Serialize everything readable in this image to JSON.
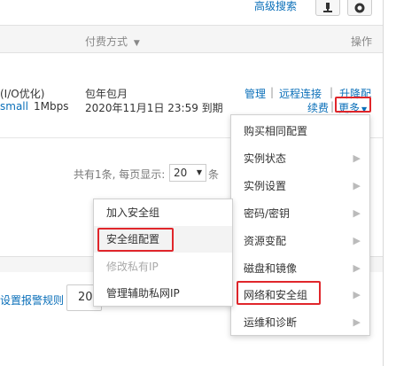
{
  "toolbar": {
    "advanced_search": "高级搜索",
    "icons": [
      "microscope-icon",
      "gear-icon"
    ]
  },
  "table": {
    "col_payment": "付费方式",
    "col_ops": "操作",
    "row": {
      "spec_line1": "(I/O优化)",
      "spec_line2_a": "small",
      "spec_line2_b": "1Mbps",
      "billing_line1": "包年包月",
      "billing_line2": "2020年11月1日 23:59 到期",
      "op_manage": "管理",
      "op_remote": "远程连接",
      "op_upgrade": "升降配",
      "op_renew": "续费",
      "op_more": "更多"
    }
  },
  "pager": {
    "summary": "共有1条, 每页显示:",
    "page_size": "20",
    "unit": "条"
  },
  "lower": {
    "alarm_link": "设置报警规则",
    "input_value": "20"
  },
  "more_menu": {
    "items": [
      {
        "label": "购买相同配置",
        "submenu": false
      },
      {
        "label": "实例状态",
        "submenu": true
      },
      {
        "label": "实例设置",
        "submenu": true
      },
      {
        "label": "密码/密钥",
        "submenu": true
      },
      {
        "label": "资源变配",
        "submenu": true
      },
      {
        "label": "磁盘和镜像",
        "submenu": true
      },
      {
        "label": "网络和安全组",
        "submenu": true
      },
      {
        "label": "运维和诊断",
        "submenu": true
      }
    ]
  },
  "sub_menu": {
    "items": [
      {
        "label": "加入安全组",
        "disabled": false
      },
      {
        "label": "安全组配置",
        "disabled": false
      },
      {
        "label": "修改私有IP",
        "disabled": true
      },
      {
        "label": "管理辅助私网IP",
        "disabled": false
      }
    ]
  },
  "colors": {
    "link": "#0a6fb9",
    "highlight_box": "#e0262b"
  }
}
